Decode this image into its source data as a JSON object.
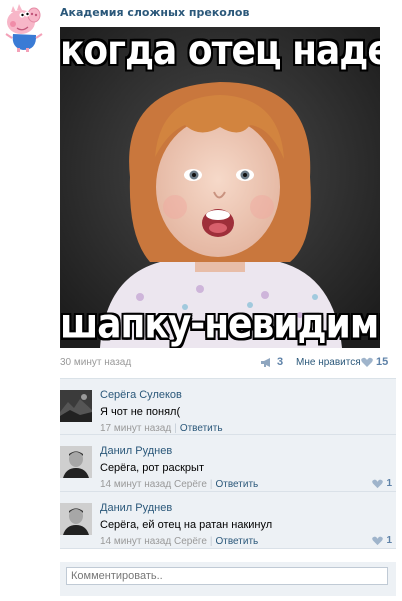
{
  "group": {
    "name": "Академия сложных преколов",
    "avatar_icon": "pig-cartoon-avatar"
  },
  "post": {
    "meme_top": "когда отец надел",
    "meme_bottom": "шапку-невидимку",
    "time": "30 минут назад",
    "shares": "3",
    "like_label": "Мне нравится",
    "likes": "15"
  },
  "comments": [
    {
      "author": "Серёга Сулеков",
      "text": "Я чот не понял(",
      "time": "17 минут назад",
      "reply_to": "",
      "reply_label": "Ответить",
      "likes": ""
    },
    {
      "author": "Данил Руднев",
      "text": "Серёга, рот раскрыт",
      "time": "14 минут назад",
      "reply_to": "Серёге",
      "reply_label": "Ответить",
      "likes": "1"
    },
    {
      "author": "Данил Руднев",
      "text": "Серёга, ей отец на ратан накинул",
      "time": "14 минут назад",
      "reply_to": "Серёге",
      "reply_label": "Ответить",
      "likes": "1"
    }
  ],
  "comment_box": {
    "placeholder": "Комментировать.."
  },
  "colors": {
    "link": "#2b587a",
    "muted": "#999999",
    "count": "#5e82a8",
    "comment_bg": "#edf1f5"
  }
}
